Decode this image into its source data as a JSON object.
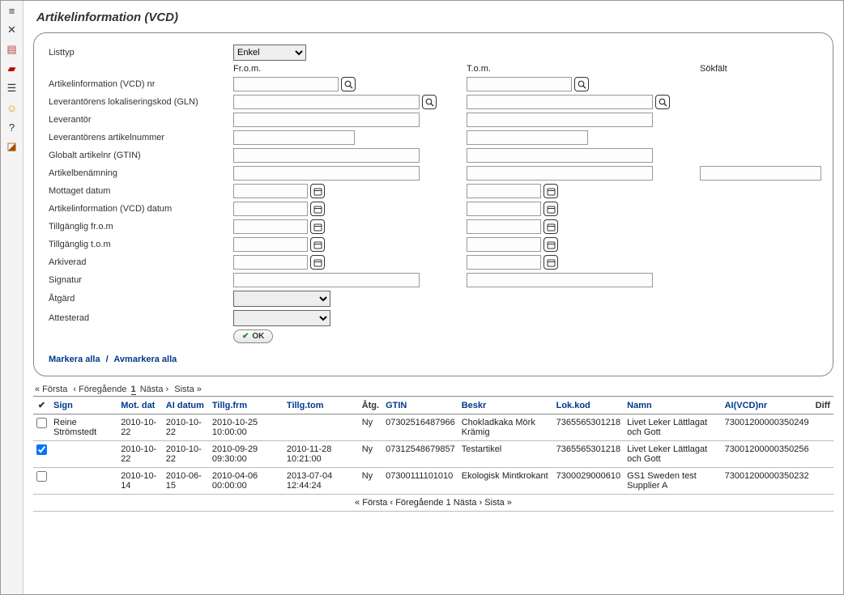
{
  "page_title": "Artikelinformation (VCD)",
  "sidebar": {
    "icons": [
      "list-icon",
      "close-icon",
      "doc-icon",
      "pdf-icon",
      "stack-icon",
      "user-icon",
      "help-icon",
      "exit-icon"
    ]
  },
  "form": {
    "listtyp_label": "Listtyp",
    "listtyp_value": "Enkel",
    "from_header": "Fr.o.m.",
    "tom_header": "T.o.m.",
    "sokfalt_header": "Sökfält",
    "rows": {
      "ai_nr_label": "Artikelinformation (VCD) nr",
      "gln_label": "Leverantörens lokaliseringskod (GLN)",
      "leverantor_label": "Leverantör",
      "lev_artnr_label": "Leverantörens artikelnummer",
      "gtin_label": "Globalt artikelnr (GTIN)",
      "benamning_label": "Artikelbenämning",
      "mottaget_label": "Mottaget datum",
      "ai_datum_label": "Artikelinformation (VCD) datum",
      "tillg_from_label": "Tillgänglig fr.o.m",
      "tillg_tom_label": "Tillgänglig t.o.m",
      "arkiverad_label": "Arkiverad",
      "signatur_label": "Signatur",
      "atgard_label": "Åtgärd",
      "attesterad_label": "Attesterad"
    },
    "ok_label": "OK",
    "markera_alla": "Markera alla",
    "avmarkera_alla": "Avmarkera alla"
  },
  "pager": {
    "first": "« Första",
    "prev": "‹ Föregående",
    "current": "1",
    "next": "Nästa ›",
    "last": "Sista »"
  },
  "table": {
    "headers": {
      "check": "✔",
      "sign": "Sign",
      "motdat": "Mot. dat",
      "aidatum": "AI datum",
      "tillgfrm": "Tillg.frm",
      "tillgtom": "Tillg.tom",
      "atg": "Åtg.",
      "gtin": "GTIN",
      "beskr": "Beskr",
      "lokkod": "Lok.kod",
      "namn": "Namn",
      "aivcdnr": "AI(VCD)nr",
      "diff": "Diff"
    },
    "rows": [
      {
        "checked": false,
        "sign": "Reine Strömstedt",
        "motdat": "2010-10-22",
        "aidatum": "2010-10-22",
        "tillgfrm": "2010-10-25 10:00:00",
        "tillgtom": "",
        "atg": "Ny",
        "gtin": "07302516487966",
        "beskr": "Chokladkaka Mörk Krämig",
        "lokkod": "7365565301218",
        "namn": "Livet Leker Lättlagat och Gott",
        "aivcdnr": "73001200000350249",
        "diff": ""
      },
      {
        "checked": true,
        "sign": "",
        "motdat": "2010-10-22",
        "aidatum": "2010-10-22",
        "tillgfrm": "2010-09-29 09:30:00",
        "tillgtom": "2010-11-28 10:21:00",
        "atg": "Ny",
        "gtin": "07312548679857",
        "beskr": "Testartikel",
        "lokkod": "7365565301218",
        "namn": "Livet Leker Lättlagat och Gott",
        "aivcdnr": "73001200000350256",
        "diff": ""
      },
      {
        "checked": false,
        "sign": "",
        "motdat": "2010-10-14",
        "aidatum": "2010-06-15",
        "tillgfrm": "2010-04-06 00:00:00",
        "tillgtom": "2013-07-04 12:44:24",
        "atg": "Ny",
        "gtin": "07300111101010",
        "beskr": "Ekologisk Mintkrokant",
        "lokkod": "7300029000610",
        "namn": "GS1 Sweden test Supplier A",
        "aivcdnr": "73001200000350232",
        "diff": ""
      }
    ]
  }
}
